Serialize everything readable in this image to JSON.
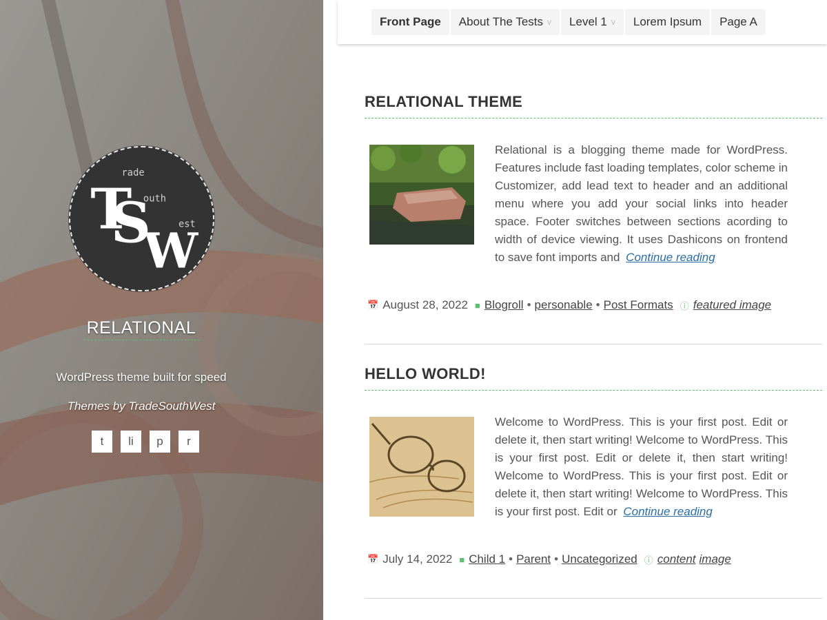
{
  "sidebar": {
    "logo_letters": "TSW",
    "logo_words": [
      "rade",
      "outh",
      "est"
    ],
    "site_title": "RELATIONAL",
    "description": "WordPress theme built for speed",
    "lead_text": "Themes by TradeSouthWest",
    "social_links": [
      {
        "label": "t",
        "icon": "twitter-icon"
      },
      {
        "label": "li",
        "icon": "linkedin-icon"
      },
      {
        "label": "p",
        "icon": "pinterest-icon"
      },
      {
        "label": "r",
        "icon": "rss-icon"
      }
    ]
  },
  "nav": {
    "items": [
      {
        "label": "Front Page",
        "has_submenu": false
      },
      {
        "label": "About The Tests",
        "has_submenu": true
      },
      {
        "label": "Level 1",
        "has_submenu": true
      },
      {
        "label": "Lorem Ipsum",
        "has_submenu": false
      },
      {
        "label": "Page A",
        "has_submenu": false
      }
    ],
    "submenu_arrow": "v"
  },
  "posts": [
    {
      "title": "RELATIONAL THEME",
      "thumbnail": "rocks-by-water",
      "excerpt": "Relational is a blogging theme made for WordPress. Features include fast loading templates, color scheme in Customizer, add lead text to header and an additional menu where you add your social links into header space. Footer switches between sections acording to width of device viewing. It uses Dashicons on frontend to save font imports and",
      "continue_label": "Continue reading",
      "date": "August 28, 2022",
      "categories": [
        "Blogroll",
        "personable",
        "Post Formats"
      ],
      "tags": [
        "featured image"
      ]
    },
    {
      "title": "HELLO WORLD!",
      "thumbnail": "eyeglasses-on-letter",
      "excerpt": "Welcome to WordPress. This is your first post. Edit or delete it, then start writing! Welcome to WordPress. This is your first post. Edit or delete it, then start writing! Welcome to WordPress. This is your first post. Edit or delete it, then start writing! Welcome to WordPress. This is your first post. Edit or",
      "continue_label": "Continue reading",
      "date": "July 14, 2022",
      "categories": [
        "Child 1",
        "Parent",
        "Uncategorized"
      ],
      "tags": [
        "content",
        "image"
      ]
    }
  ],
  "meta_separator": "•",
  "colors": {
    "accent": "#5fbf6e",
    "link": "#2a6ea5",
    "logo_bg": "#333333"
  }
}
